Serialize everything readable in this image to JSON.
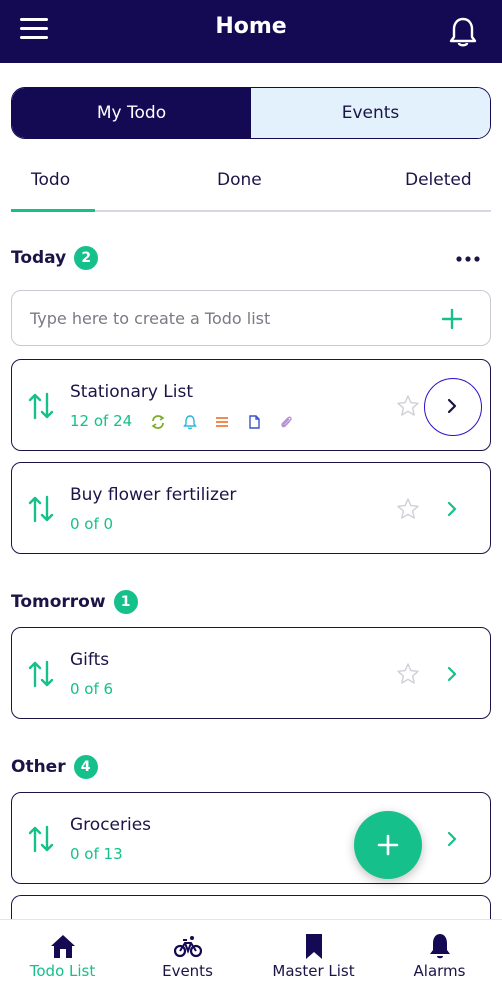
{
  "header": {
    "title": "Home"
  },
  "segment": {
    "left": "My Todo",
    "right": "Events"
  },
  "tabs": [
    {
      "label": "Todo",
      "active": true
    },
    {
      "label": "Done",
      "active": false
    },
    {
      "label": "Deleted",
      "active": false
    }
  ],
  "create": {
    "placeholder": "Type here to create a Todo list"
  },
  "sections": {
    "today": {
      "label": "Today",
      "count": "2"
    },
    "tomorrow": {
      "label": "Tomorrow",
      "count": "1"
    },
    "other": {
      "label": "Other",
      "count": "4"
    }
  },
  "lists": {
    "stationary": {
      "name": "Stationary List",
      "count": "12 of 24",
      "icons": [
        "repeat-icon",
        "bell-icon",
        "list-icon",
        "document-icon",
        "paperclip-icon"
      ]
    },
    "fertilizer": {
      "name": "Buy flower fertilizer",
      "count": "0 of 0"
    },
    "gifts": {
      "name": "Gifts",
      "count": "0 of 6"
    },
    "groceries": {
      "name": "Groceries",
      "count": "0 of 13"
    }
  },
  "bottom_nav": [
    {
      "label": "Todo List",
      "icon": "home-icon",
      "active": true
    },
    {
      "label": "Events",
      "icon": "bicycle-icon",
      "active": false
    },
    {
      "label": "Master List",
      "icon": "bookmark-icon",
      "active": false
    },
    {
      "label": "Alarms",
      "icon": "bell-icon",
      "active": false
    }
  ],
  "colors": {
    "primary": "#140a54",
    "accent": "#16c08a",
    "segment_inactive": "#e3f1fc"
  }
}
